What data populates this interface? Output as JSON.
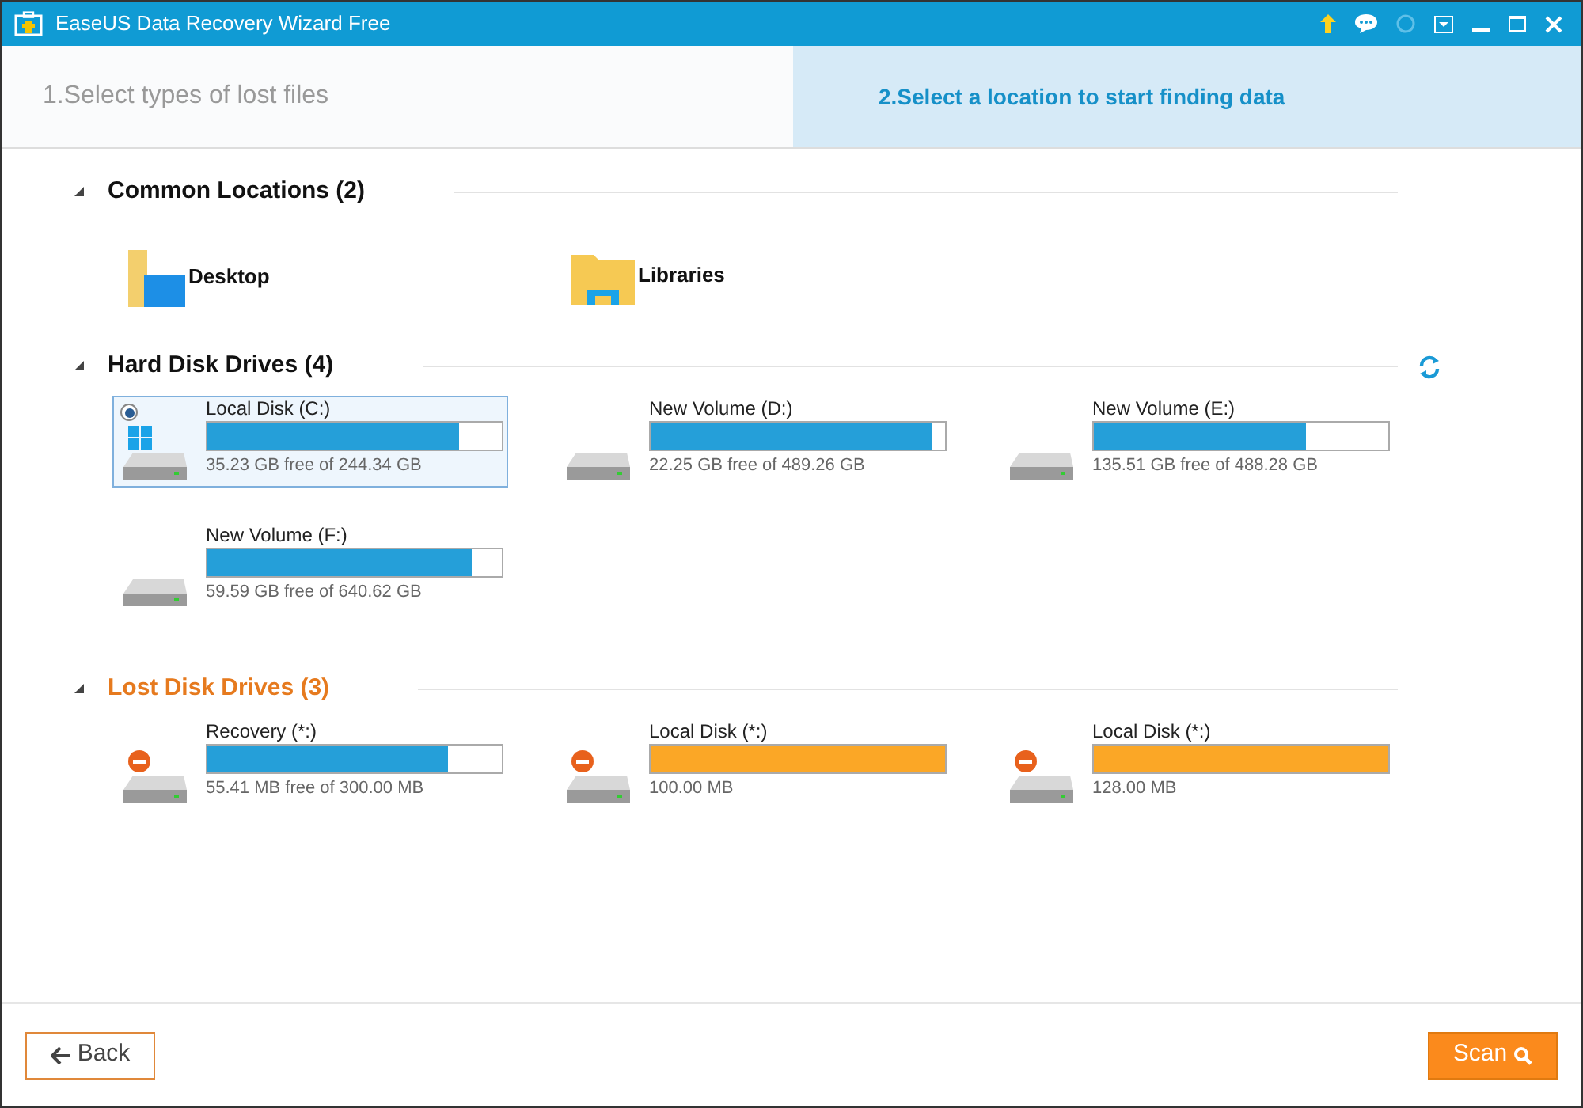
{
  "window": {
    "title": "EaseUS Data Recovery Wizard Free"
  },
  "steps": [
    {
      "label": "1.Select types of lost files",
      "selected": false
    },
    {
      "label": "2.Select a location to start finding data",
      "selected": true
    }
  ],
  "sections": [
    {
      "kind": "locations",
      "title": "Common Locations (2)",
      "expanded": true,
      "items": [
        {
          "kind": "desktop",
          "name": "Desktop"
        },
        {
          "kind": "libraries",
          "name": "Libraries"
        }
      ]
    },
    {
      "kind": "drives",
      "title": "Hard Disk Drives (4)",
      "expanded": true,
      "refresh": true,
      "items": [
        {
          "kind": "system",
          "name": "Local Disk (C:)",
          "level": 0.856,
          "info": "35.23 GB free of 244.34 GB",
          "selected": true
        },
        {
          "kind": "disk",
          "name": "New Volume (D:)",
          "level": 0.955,
          "info": "22.25 GB free of 489.26 GB",
          "selected": false
        },
        {
          "kind": "disk",
          "name": "New Volume (E:)",
          "level": 0.72,
          "info": "135.51 GB free of 488.28 GB",
          "selected": false
        },
        {
          "kind": "disk",
          "name": "New Volume (F:)",
          "level": 0.9,
          "info": "59.59 GB free of 640.62 GB",
          "selected": false
        }
      ]
    },
    {
      "kind": "lost",
      "title": "Lost Disk Drives (3)",
      "expanded": true,
      "items": [
        {
          "kind": "lost",
          "name": "Recovery (*:)",
          "level": 0.815,
          "info": "55.41 MB free of 300.00 MB",
          "selected": false
        },
        {
          "kind": "unknown",
          "name": "Local Disk (*:)",
          "level": 1,
          "info": "100.00 MB",
          "selected": false
        },
        {
          "kind": "unknown",
          "name": "Local Disk (*:)",
          "level": 1,
          "info": "128.00 MB",
          "selected": false
        }
      ]
    }
  ],
  "buttons": {
    "back": "Back",
    "scan": "Scan"
  }
}
